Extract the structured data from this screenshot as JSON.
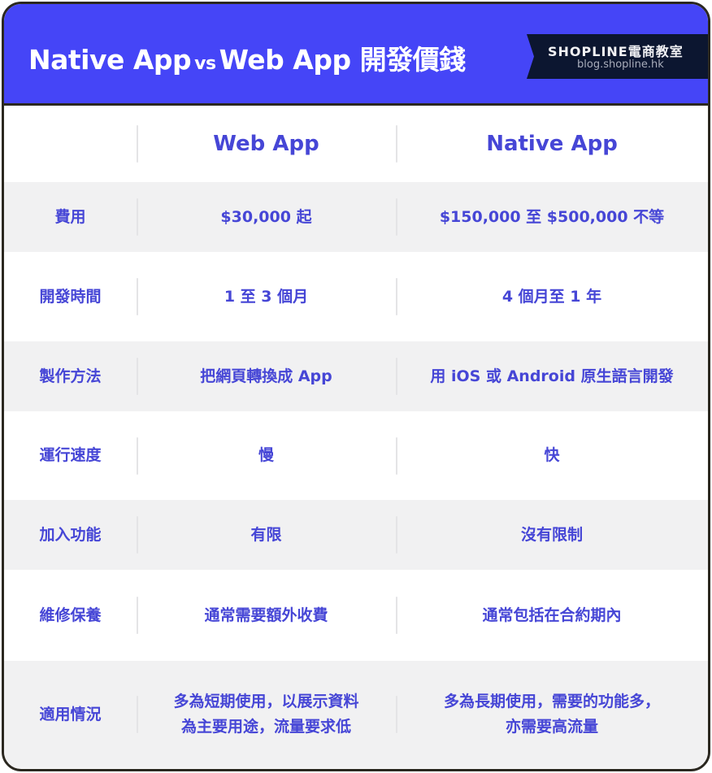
{
  "banner": {
    "title_part1": "Native App",
    "title_vs": "vs",
    "title_part2": "Web App 開發價錢",
    "brand_name": "SHOPLINE電商教室",
    "brand_url": "blog.shopline.hk"
  },
  "colors": {
    "banner_bg": "#4545F7",
    "ribbon_bg": "#0C1630",
    "text_accent": "#4646D6",
    "row_alt_bg": "#F1F1F2",
    "frame_border": "#2b2820"
  },
  "table": {
    "headers": [
      "",
      "Web App",
      "Native App"
    ],
    "rows": [
      {
        "label": "費用",
        "web": "$30,000 起",
        "native": "$150,000 至 $500,000 不等"
      },
      {
        "label": "開發時間",
        "web": "1 至 3 個月",
        "native": "4 個月至 1 年"
      },
      {
        "label": "製作方法",
        "web": "把網頁轉換成 App",
        "native": "用 iOS 或 Android 原生語言開發"
      },
      {
        "label": "運行速度",
        "web": "慢",
        "native": "快"
      },
      {
        "label": "加入功能",
        "web": "有限",
        "native": "沒有限制"
      },
      {
        "label": "維修保養",
        "web": "通常需要額外收費",
        "native": "通常包括在合約期內"
      },
      {
        "label": "適用情況",
        "web": "多為短期使用，以展示資料\n為主要用途，流量要求低",
        "native": "多為長期使用，需要的功能多，\n亦需要高流量"
      }
    ]
  }
}
